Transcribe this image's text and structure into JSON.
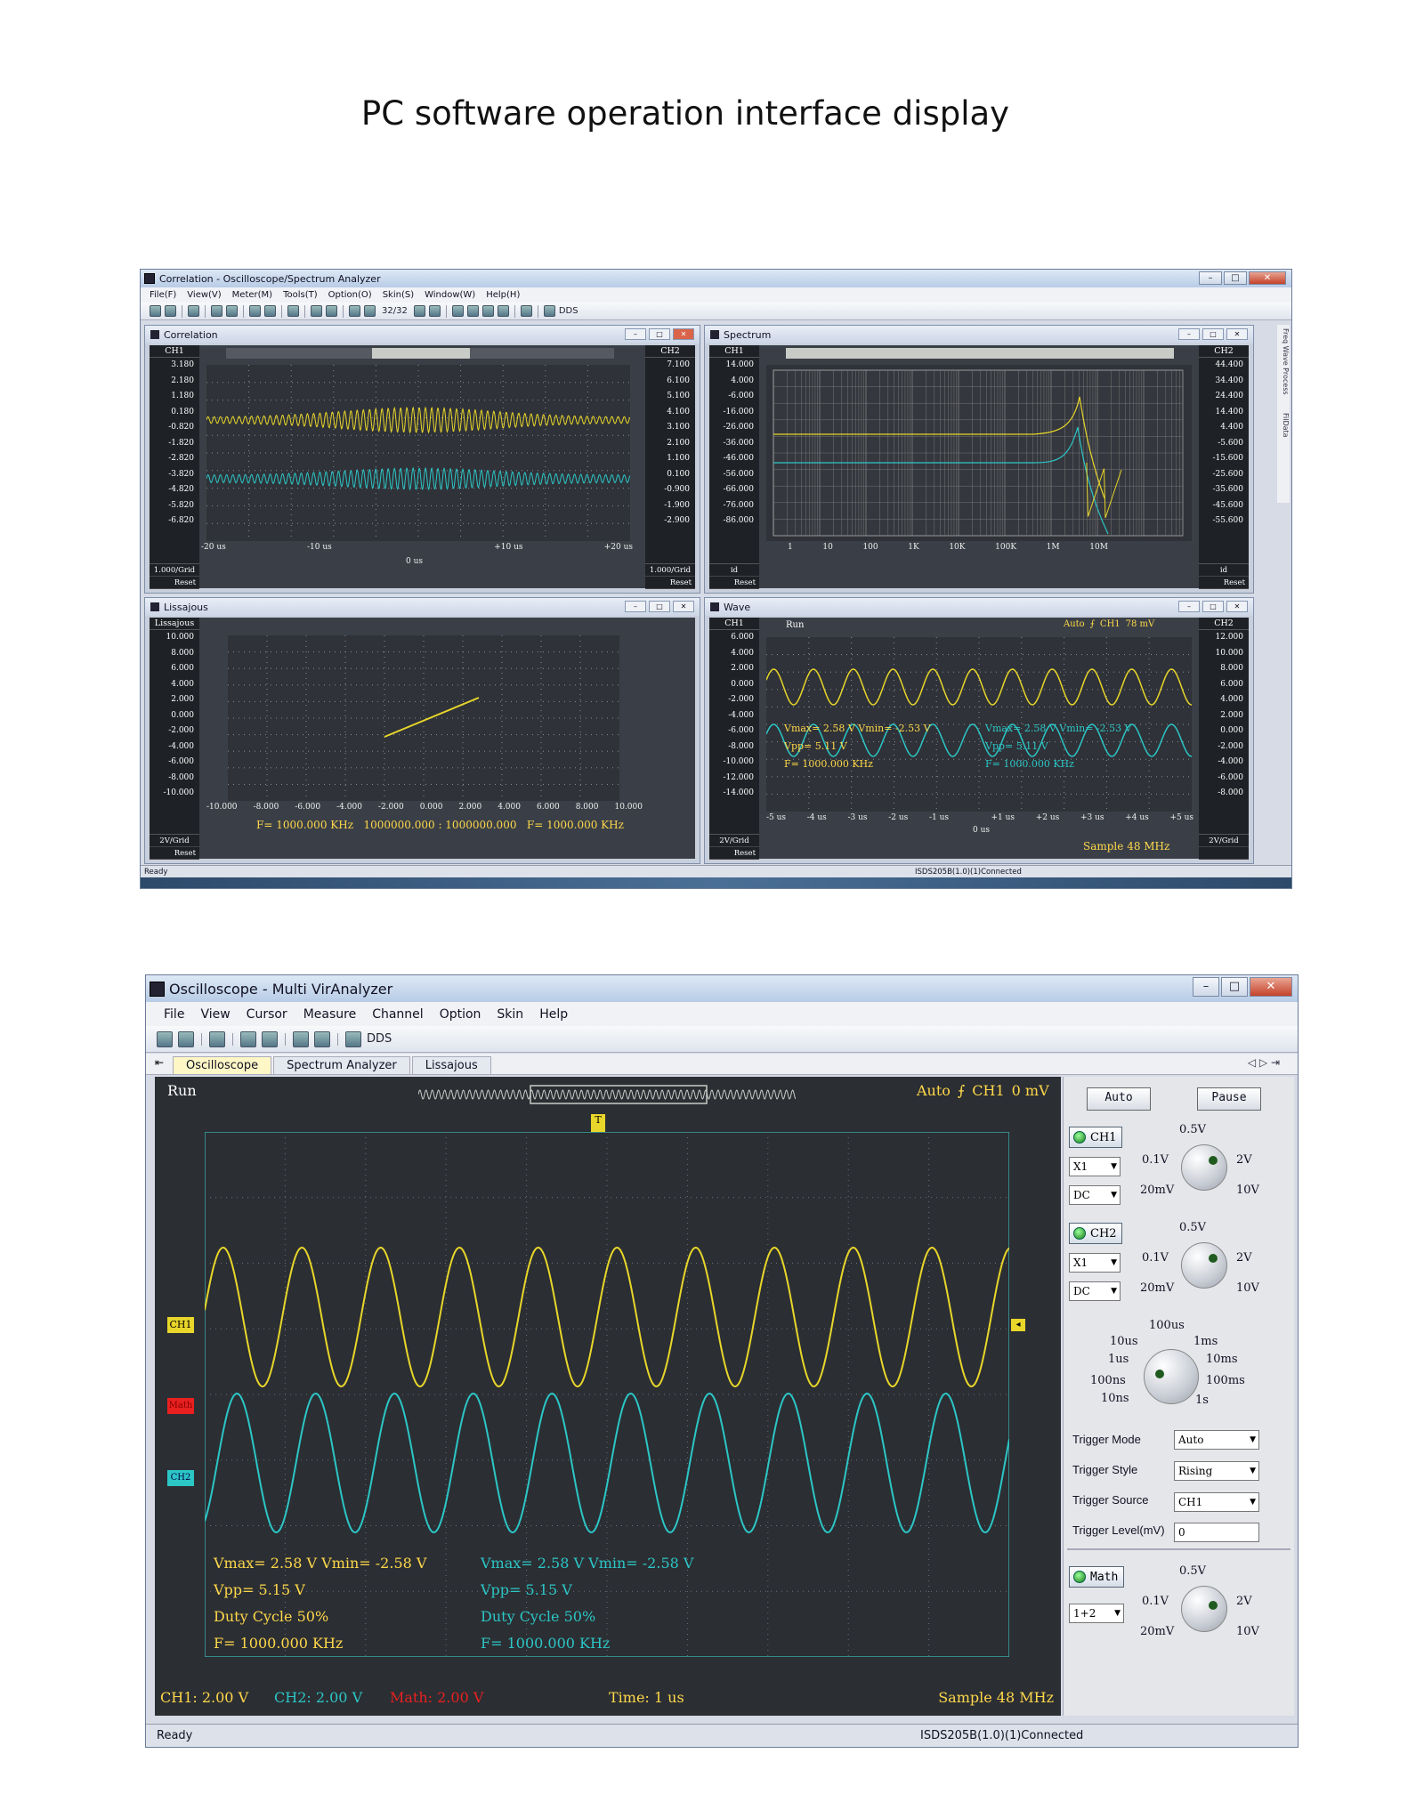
{
  "page_title": "PC software operation interface display",
  "win1": {
    "title": "Correlation - Oscilloscope/Spectrum Analyzer",
    "menu": [
      "File(F)",
      "View(V)",
      "Meter(M)",
      "Tools(T)",
      "Option(O)",
      "Skin(S)",
      "Window(W)",
      "Help(H)"
    ],
    "toolbar_page": "32/32",
    "toolbar_dds": "DDS",
    "side_tabs": [
      "Freq Wave Process",
      "FilData"
    ],
    "status_left": "Ready",
    "status_right": "ISDS205B(1.0)(1)Connected",
    "correlation": {
      "title": "Correlation",
      "ch1": "CH1",
      "ch2": "CH2",
      "ch1_vals": [
        "3.180",
        "2.180",
        "1.180",
        "0.180",
        "-0.820",
        "-1.820",
        "-2.820",
        "-3.820",
        "-4.820",
        "-5.820",
        "-6.820"
      ],
      "ch2_vals": [
        "7.100",
        "6.100",
        "5.100",
        "4.100",
        "3.100",
        "2.100",
        "1.100",
        "0.100",
        "-0.900",
        "-1.900",
        "-2.900"
      ],
      "foot_grid": "1.000/Grid",
      "foot_reset": "Reset",
      "x_labels": [
        "-20 us",
        "-10 us",
        "",
        "+10 us",
        "+20 us"
      ],
      "x_center": "0 us"
    },
    "spectrum": {
      "title": "Spectrum",
      "ch1": "CH1",
      "ch2": "CH2",
      "ch1_vals": [
        "14.000",
        "4.000",
        "-6.000",
        "-16.000",
        "-26.000",
        "-36.000",
        "-46.000",
        "-56.000",
        "-66.000",
        "-76.000",
        "-86.000"
      ],
      "ch2_vals": [
        "44.400",
        "34.400",
        "24.400",
        "14.400",
        "4.400",
        "-5.600",
        "-15.600",
        "-25.600",
        "-35.600",
        "-45.600",
        "-55.600"
      ],
      "foot_grid": "id",
      "foot_reset": "Reset",
      "x_labels": [
        "1",
        "10",
        "100",
        "1K",
        "10K",
        "100K",
        "1M",
        "10M"
      ]
    },
    "lissajous": {
      "title": "Lissajous",
      "hdr": "Lissajous",
      "y_vals": [
        "10.000",
        "8.000",
        "6.000",
        "4.000",
        "2.000",
        "0.000",
        "-2.000",
        "-4.000",
        "-6.000",
        "-8.000",
        "-10.000"
      ],
      "x_labels": [
        "-10.000",
        "-8.000",
        "-6.000",
        "-4.000",
        "-2.000",
        "0.000",
        "2.000",
        "4.000",
        "6.000",
        "8.000",
        "10.000"
      ],
      "foot_grid": "2V/Grid",
      "foot_reset": "Reset",
      "bottom_info": "F= 1000.000 KHz   1000000.000 : 1000000.000   F= 1000.000 KHz"
    },
    "wave": {
      "title": "Wave",
      "ch1": "CH1",
      "ch2": "CH2",
      "run": "Run",
      "trig": "Auto",
      "trig_ch": "CH1",
      "trig_level": "78 mV",
      "ch1_vals": [
        "6.000",
        "4.000",
        "2.000",
        "0.000",
        "-2.000",
        "-4.000",
        "-6.000",
        "-8.000",
        "-10.000",
        "-12.000",
        "-14.000"
      ],
      "ch2_vals": [
        "12.000",
        "10.000",
        "8.000",
        "6.000",
        "4.000",
        "2.000",
        "0.000",
        "-2.000",
        "-4.000",
        "-6.000",
        "-8.000"
      ],
      "m1": "Vmax= 2.58 V  Vmin= -2.53 V",
      "m2": "Vpp= 5.11 V",
      "m3": "F= 1000.000 KHz",
      "m4": "Vmax= 2.58 V  Vmin= -2.53 V",
      "m5": "Vpp= 5.11 V",
      "m6": "F= 1000.000 KHz",
      "x_labels": [
        "-5 us",
        "-4 us",
        "-3 us",
        "-2 us",
        "-1 us",
        "",
        "+1 us",
        "+2 us",
        "+3 us",
        "+4 us",
        "+5 us"
      ],
      "x_center": "0 us",
      "sample": "Sample 48 MHz",
      "foot_grid": "2V/Grid",
      "foot_reset": "Reset",
      "foot_grid2": "2V/Grid"
    }
  },
  "win2": {
    "title": "Oscilloscope - Multi VirAnalyzer",
    "menu": [
      "File",
      "View",
      "Cursor",
      "Measure",
      "Channel",
      "Option",
      "Skin",
      "Help"
    ],
    "toolbar_dds": "DDS",
    "tabs": [
      "Oscilloscope",
      "Spectrum Analyzer",
      "Lissajous"
    ],
    "tab_nav": "◁ ▷ ⇥",
    "run": "Run",
    "trig_mode_label": "Auto",
    "trig_ch": "CH1",
    "trig_level": "0 mV",
    "marker_ch1": "CH1",
    "marker_math": "Math",
    "marker_ch2": "CH2",
    "marker_t": "T",
    "meas_left": [
      "Vmax= 2.58 V  Vmin= -2.58 V",
      "Vpp= 5.15 V",
      "Duty Cycle 50%",
      "F= 1000.000 KHz"
    ],
    "meas_right": [
      "Vmax= 2.58 V  Vmin= -2.58 V",
      "Vpp= 5.15 V",
      "Duty Cycle 50%",
      "F= 1000.000 KHz"
    ],
    "bottom": {
      "ch1": "CH1: 2.00 V",
      "ch2": "CH2: 2.00 V",
      "math": "Math: 2.00 V",
      "time": "Time: 1 us",
      "sample": "Sample 48 MHz"
    },
    "auto_btn": "Auto",
    "pause_btn": "Pause",
    "ch1_btn": "CH1",
    "ch2_btn": "CH2",
    "math_btn": "Math",
    "probe": "X1",
    "coupling": "DC",
    "math_op": "1+2",
    "volt_knob": {
      "top": "0.5V",
      "l1": "0.1V",
      "r1": "2V",
      "l2": "20mV",
      "r2": "10V"
    },
    "time_knob": {
      "top": "100us",
      "tl": "10us",
      "tr": "1ms",
      "l1": "1us",
      "r1": "10ms",
      "l2": "100ns",
      "r2": "100ms",
      "bl": "10ns",
      "br": "1s"
    },
    "trigger_mode_label": "Trigger Mode",
    "trigger_mode": "Auto",
    "trigger_style_label": "Trigger Style",
    "trigger_style": "Rising",
    "trigger_source_label": "Trigger Source",
    "trigger_source": "CH1",
    "trigger_level_label": "Trigger Level(mV)",
    "trigger_level_value": "0",
    "status_left": "Ready",
    "status_right": "ISDS205B(1.0)(1)Connected"
  },
  "colors": {
    "ch1": "#e8d62a",
    "ch2": "#2cc6c6",
    "math": "#e82020",
    "bg": "#2b2e33",
    "grid": "#7a7f88"
  }
}
